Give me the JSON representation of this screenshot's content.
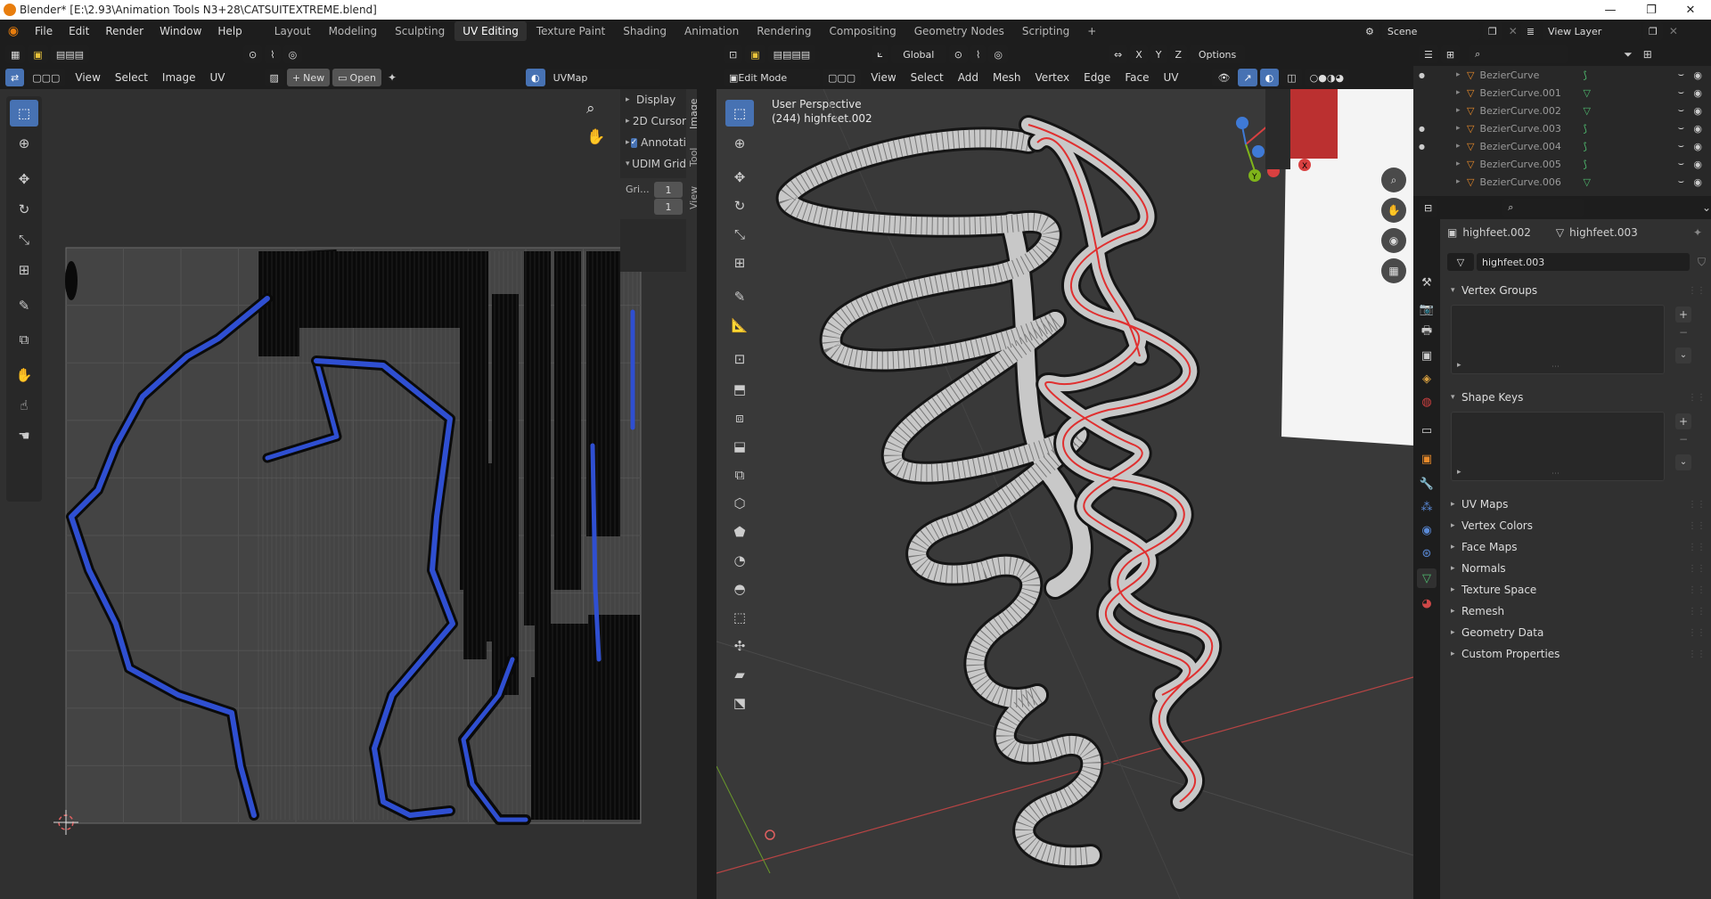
{
  "window": {
    "title": "Blender* [E:\\2.93\\Animation Tools N3+28\\CATSUITEXTREME.blend]",
    "minimize": "—",
    "maximize": "❐",
    "close": "✕"
  },
  "menus": [
    "File",
    "Edit",
    "Render",
    "Window",
    "Help"
  ],
  "workspaces": [
    "Layout",
    "Modeling",
    "Sculpting",
    "UV Editing",
    "Texture Paint",
    "Shading",
    "Animation",
    "Rendering",
    "Compositing",
    "Geometry Nodes",
    "Scripting",
    "+"
  ],
  "active_workspace": "UV Editing",
  "scene": {
    "label": "Scene",
    "view_layer": "View Layer"
  },
  "uv_editor": {
    "header_menus": [
      "View",
      "Select",
      "Image",
      "UV"
    ],
    "new_label": "New",
    "open_label": "Open",
    "uvmap": "UVMap",
    "side_tabs": [
      "Image",
      "Tool",
      "View"
    ],
    "panels": [
      {
        "label": "Display",
        "expanded": false
      },
      {
        "label": "2D Cursor",
        "expanded": false
      },
      {
        "label": "Annotati",
        "expanded": false,
        "checkbox": true
      },
      {
        "label": "UDIM Grid",
        "expanded": true
      }
    ],
    "grid_label": "Gri...",
    "grid_x": "1",
    "grid_y": "1"
  },
  "viewport": {
    "orientation": "Global",
    "options_label": "Options",
    "mode": "Edit Mode",
    "header_menus": [
      "View",
      "Select",
      "Add",
      "Mesh",
      "Vertex",
      "Edge",
      "Face",
      "UV"
    ],
    "perspective_label": "User Perspective",
    "object_label": "(244) highfeet.002",
    "axes": [
      "X",
      "Y",
      "Z"
    ]
  },
  "outliner": {
    "items": [
      {
        "name": "BezierCurve",
        "icon": "curve"
      },
      {
        "name": "BezierCurve.001",
        "icon": "mesh"
      },
      {
        "name": "BezierCurve.002",
        "icon": "mesh"
      },
      {
        "name": "BezierCurve.003",
        "icon": "curve"
      },
      {
        "name": "BezierCurve.004",
        "icon": "curve"
      },
      {
        "name": "BezierCurve.005",
        "icon": "curve"
      },
      {
        "name": "BezierCurve.006",
        "icon": "mesh"
      }
    ]
  },
  "properties": {
    "object_name": "highfeet.002",
    "mesh_name": "highfeet.003",
    "data_field": "highfeet.003",
    "sections": [
      {
        "label": "Vertex Groups",
        "expanded": true
      },
      {
        "label": "Shape Keys",
        "expanded": true
      },
      {
        "label": "UV Maps",
        "expanded": false
      },
      {
        "label": "Vertex Colors",
        "expanded": false
      },
      {
        "label": "Face Maps",
        "expanded": false
      },
      {
        "label": "Normals",
        "expanded": false
      },
      {
        "label": "Texture Space",
        "expanded": false
      },
      {
        "label": "Remesh",
        "expanded": false
      },
      {
        "label": "Geometry Data",
        "expanded": false
      },
      {
        "label": "Custom Properties",
        "expanded": false
      }
    ]
  },
  "colors": {
    "accent": "#4772b3",
    "uv_island": "#2f4fd1",
    "edge_seam": "#e03030",
    "axis_x": "#d94040",
    "axis_y": "#7fb41a",
    "axis_z": "#3f7ad6"
  }
}
